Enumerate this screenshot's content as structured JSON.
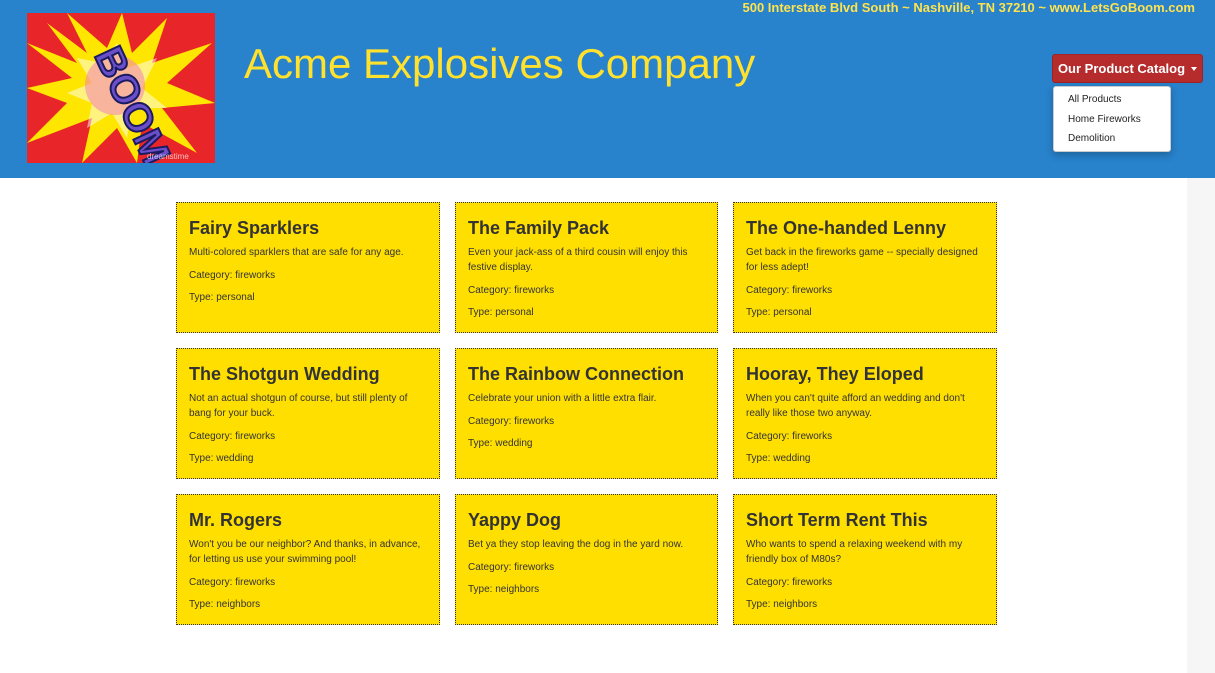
{
  "header": {
    "address": "500 Interstate Blvd South ~ Nashville, TN 37210 ~ www.LetsGoBoom.com",
    "title": "Acme Explosives Company",
    "logo_text": "BOOM",
    "logo_watermark": "dreamstime",
    "bg_color": "#2882cc",
    "title_color": "#ffe12e"
  },
  "catalog": {
    "button_label": "Our Product Catalog",
    "button_color": "#b62c2c",
    "items": [
      "All Products",
      "Home Fireworks",
      "Demolition"
    ]
  },
  "products": [
    {
      "title": "Fairy Sparklers",
      "desc": "Multi-colored sparklers that are safe for any age.",
      "category": "Category: fireworks",
      "type": "Type: personal"
    },
    {
      "title": "The Family Pack",
      "desc": "Even your jack-ass of a third cousin will enjoy this festive display.",
      "category": "Category: fireworks",
      "type": "Type: personal"
    },
    {
      "title": "The One-handed Lenny",
      "desc": "Get back in the fireworks game -- specially designed for less adept!",
      "category": "Category: fireworks",
      "type": "Type: personal"
    },
    {
      "title": "The Shotgun Wedding",
      "desc": "Not an actual shotgun of course, but still plenty of bang for your buck.",
      "category": "Category: fireworks",
      "type": "Type: wedding"
    },
    {
      "title": "The Rainbow Connection",
      "desc": "Celebrate your union with a little extra flair.",
      "category": "Category: fireworks",
      "type": "Type: wedding"
    },
    {
      "title": "Hooray, They Eloped",
      "desc": "When you can't quite afford an wedding and don't really like those two anyway.",
      "category": "Category: fireworks",
      "type": "Type: wedding"
    },
    {
      "title": "Mr. Rogers",
      "desc": "Won't you be our neighbor? And thanks, in advance, for letting us use your swimming pool!",
      "category": "Category: fireworks",
      "type": "Type: neighbors"
    },
    {
      "title": "Yappy Dog",
      "desc": "Bet ya they stop leaving the dog in the yard now.",
      "category": "Category: fireworks",
      "type": "Type: neighbors"
    },
    {
      "title": "Short Term Rent This",
      "desc": "Who wants to spend a relaxing weekend with my friendly box of M80s?",
      "category": "Category: fireworks",
      "type": "Type: neighbors"
    }
  ],
  "card_color": "#ffdf00"
}
